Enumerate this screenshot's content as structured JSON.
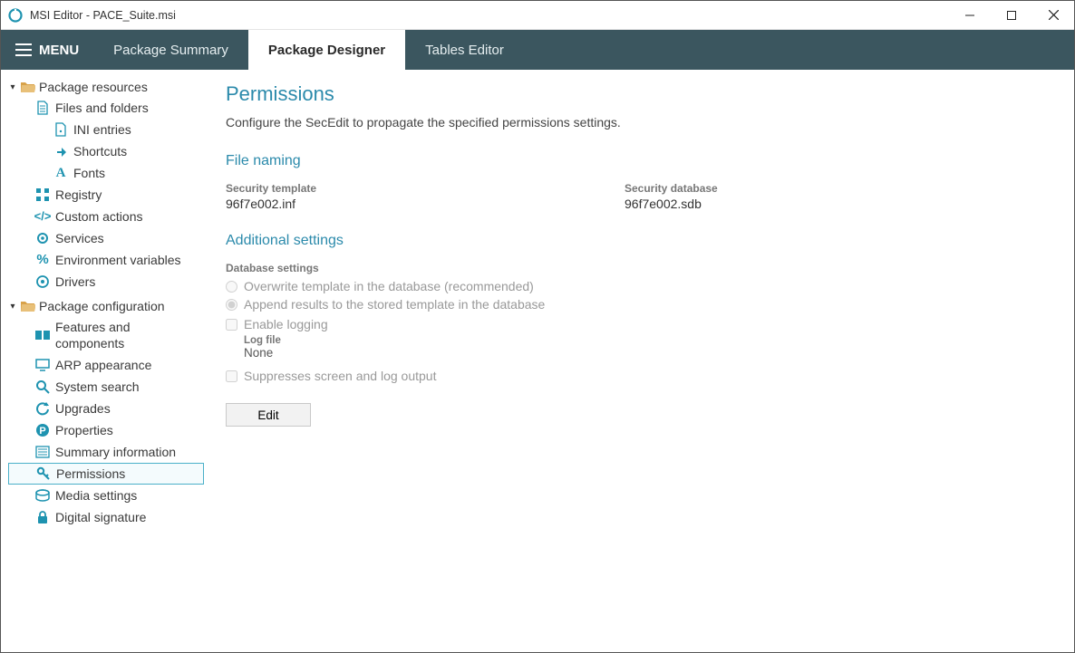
{
  "window": {
    "title": "MSI Editor - PACE_Suite.msi"
  },
  "menubar": {
    "menu_label": "MENU",
    "tabs": [
      {
        "label": "Package Summary",
        "active": false
      },
      {
        "label": "Package Designer",
        "active": true
      },
      {
        "label": "Tables Editor",
        "active": false
      }
    ]
  },
  "sidebar": {
    "sections": [
      {
        "label": "Package resources",
        "items": [
          {
            "label": "Files and folders"
          },
          {
            "label": "INI entries",
            "sub": true
          },
          {
            "label": "Shortcuts",
            "sub": true
          },
          {
            "label": "Fonts",
            "sub": true
          },
          {
            "label": "Registry"
          },
          {
            "label": "Custom actions"
          },
          {
            "label": "Services"
          },
          {
            "label": "Environment variables"
          },
          {
            "label": "Drivers"
          }
        ]
      },
      {
        "label": "Package configuration",
        "items": [
          {
            "label": "Features and components"
          },
          {
            "label": "ARP appearance"
          },
          {
            "label": "System search"
          },
          {
            "label": "Upgrades"
          },
          {
            "label": "Properties"
          },
          {
            "label": "Summary information"
          },
          {
            "label": "Permissions",
            "selected": true
          },
          {
            "label": "Media settings"
          },
          {
            "label": "Digital signature"
          }
        ]
      }
    ]
  },
  "main": {
    "title": "Permissions",
    "description": "Configure the SecEdit to propagate the specified permissions settings.",
    "file_naming": {
      "heading": "File naming",
      "template_label": "Security template",
      "template_value": "96f7e002.inf",
      "database_label": "Security database",
      "database_value": "96f7e002.sdb"
    },
    "additional": {
      "heading": "Additional settings",
      "db_settings_label": "Database settings",
      "radio_overwrite": "Overwrite template in the database (recommended)",
      "radio_append": "Append results to the stored template in the database",
      "radio_selected": "append",
      "enable_logging_label": "Enable logging",
      "enable_logging_checked": false,
      "log_file_label": "Log file",
      "log_file_value": "None",
      "suppress_label": "Suppresses screen and log output",
      "suppress_checked": false
    },
    "edit_button": "Edit"
  }
}
